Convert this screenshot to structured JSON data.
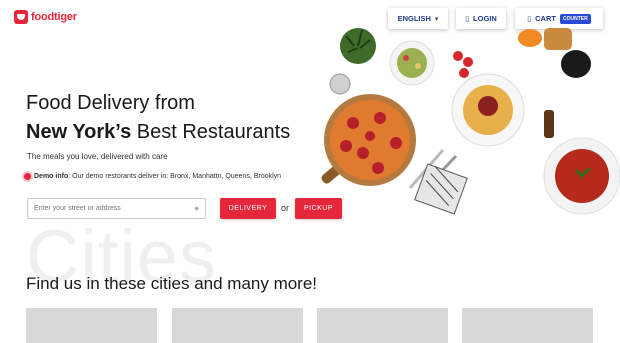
{
  "brand": {
    "name": "foodtiger",
    "color": "#e6263b"
  },
  "nav": {
    "language": {
      "label": "ENGLISH",
      "icon": "chevron-down-icon"
    },
    "login": {
      "label": "LOGIN",
      "icon": "user-icon"
    },
    "cart": {
      "label": "CART",
      "icon": "cart-icon",
      "counter_label": "COUNTER"
    }
  },
  "hero": {
    "line1": "Food Delivery from",
    "line2_bold": "New York’s",
    "line2_rest": " Best Restaurants",
    "tagline": "The meals you love, delivered with care",
    "demo_label": "Demo info",
    "demo_text": ": Our demo restorants deliver in: Bronx, Manhattn, Queens, Brooklyn"
  },
  "search": {
    "placeholder": "Enter your street or address",
    "delivery_label": "DELIVERY",
    "or_label": "or",
    "pickup_label": "PICKUP"
  },
  "cities": {
    "background_word": "Cities",
    "title": "Find us in these cities and many more!",
    "cards": [
      {},
      {},
      {},
      {}
    ]
  },
  "colors": {
    "accent": "#e6263b",
    "nav_text": "#1f3a8a",
    "counter_bg": "#2a4bd7"
  }
}
